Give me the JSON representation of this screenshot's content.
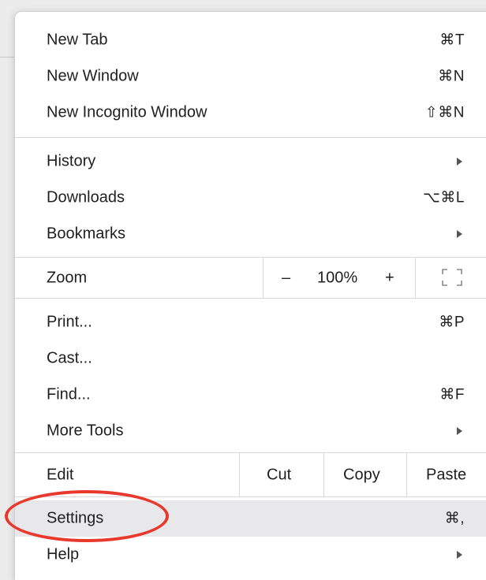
{
  "menu": {
    "new_tab": {
      "label": "New Tab",
      "shortcut": "⌘T"
    },
    "new_window": {
      "label": "New Window",
      "shortcut": "⌘N"
    },
    "new_incognito": {
      "label": "New Incognito Window",
      "shortcut": "⇧⌘N"
    },
    "history": {
      "label": "History"
    },
    "downloads": {
      "label": "Downloads",
      "shortcut": "⌥⌘L"
    },
    "bookmarks": {
      "label": "Bookmarks"
    },
    "zoom": {
      "label": "Zoom",
      "minus": "–",
      "level": "100%",
      "plus": "+",
      "fullscreen_icon": "fullscreen-icon"
    },
    "print": {
      "label": "Print...",
      "shortcut": "⌘P"
    },
    "cast": {
      "label": "Cast..."
    },
    "find": {
      "label": "Find...",
      "shortcut": "⌘F"
    },
    "more_tools": {
      "label": "More Tools"
    },
    "edit": {
      "label": "Edit",
      "cut": "Cut",
      "copy": "Copy",
      "paste": "Paste"
    },
    "settings": {
      "label": "Settings",
      "shortcut": "⌘,"
    },
    "help": {
      "label": "Help"
    }
  },
  "highlight_color": "#e8392c",
  "hover_color": "#e8e8ea"
}
